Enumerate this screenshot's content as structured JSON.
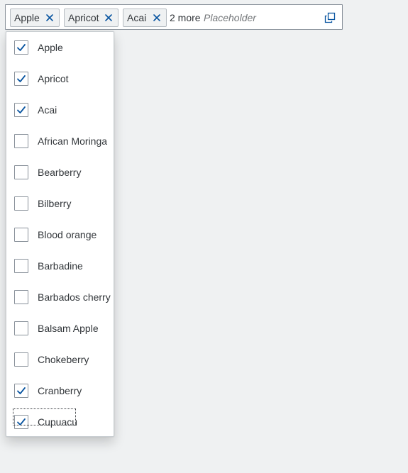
{
  "combo": {
    "tokens": [
      {
        "label": "Apple"
      },
      {
        "label": "Apricot"
      },
      {
        "label": "Acai"
      }
    ],
    "more_text": "2 more",
    "placeholder": "Placeholder",
    "value_help_icon": "value-help-icon"
  },
  "list": {
    "items": [
      {
        "label": "Apple",
        "checked": true
      },
      {
        "label": "Apricot",
        "checked": true
      },
      {
        "label": "Acai",
        "checked": true
      },
      {
        "label": "African Moringa",
        "checked": false
      },
      {
        "label": "Bearberry",
        "checked": false
      },
      {
        "label": "Bilberry",
        "checked": false
      },
      {
        "label": "Blood orange",
        "checked": false
      },
      {
        "label": "Barbadine",
        "checked": false
      },
      {
        "label": "Barbados cherry",
        "checked": false
      },
      {
        "label": "Balsam Apple",
        "checked": false
      },
      {
        "label": "Chokeberry",
        "checked": false
      },
      {
        "label": "Cranberry",
        "checked": true
      },
      {
        "label": "Cupuacu",
        "checked": true
      }
    ]
  },
  "colors": {
    "accent": "#0a6ed1",
    "checkmark": "#0854a0",
    "text": "#32363a"
  }
}
